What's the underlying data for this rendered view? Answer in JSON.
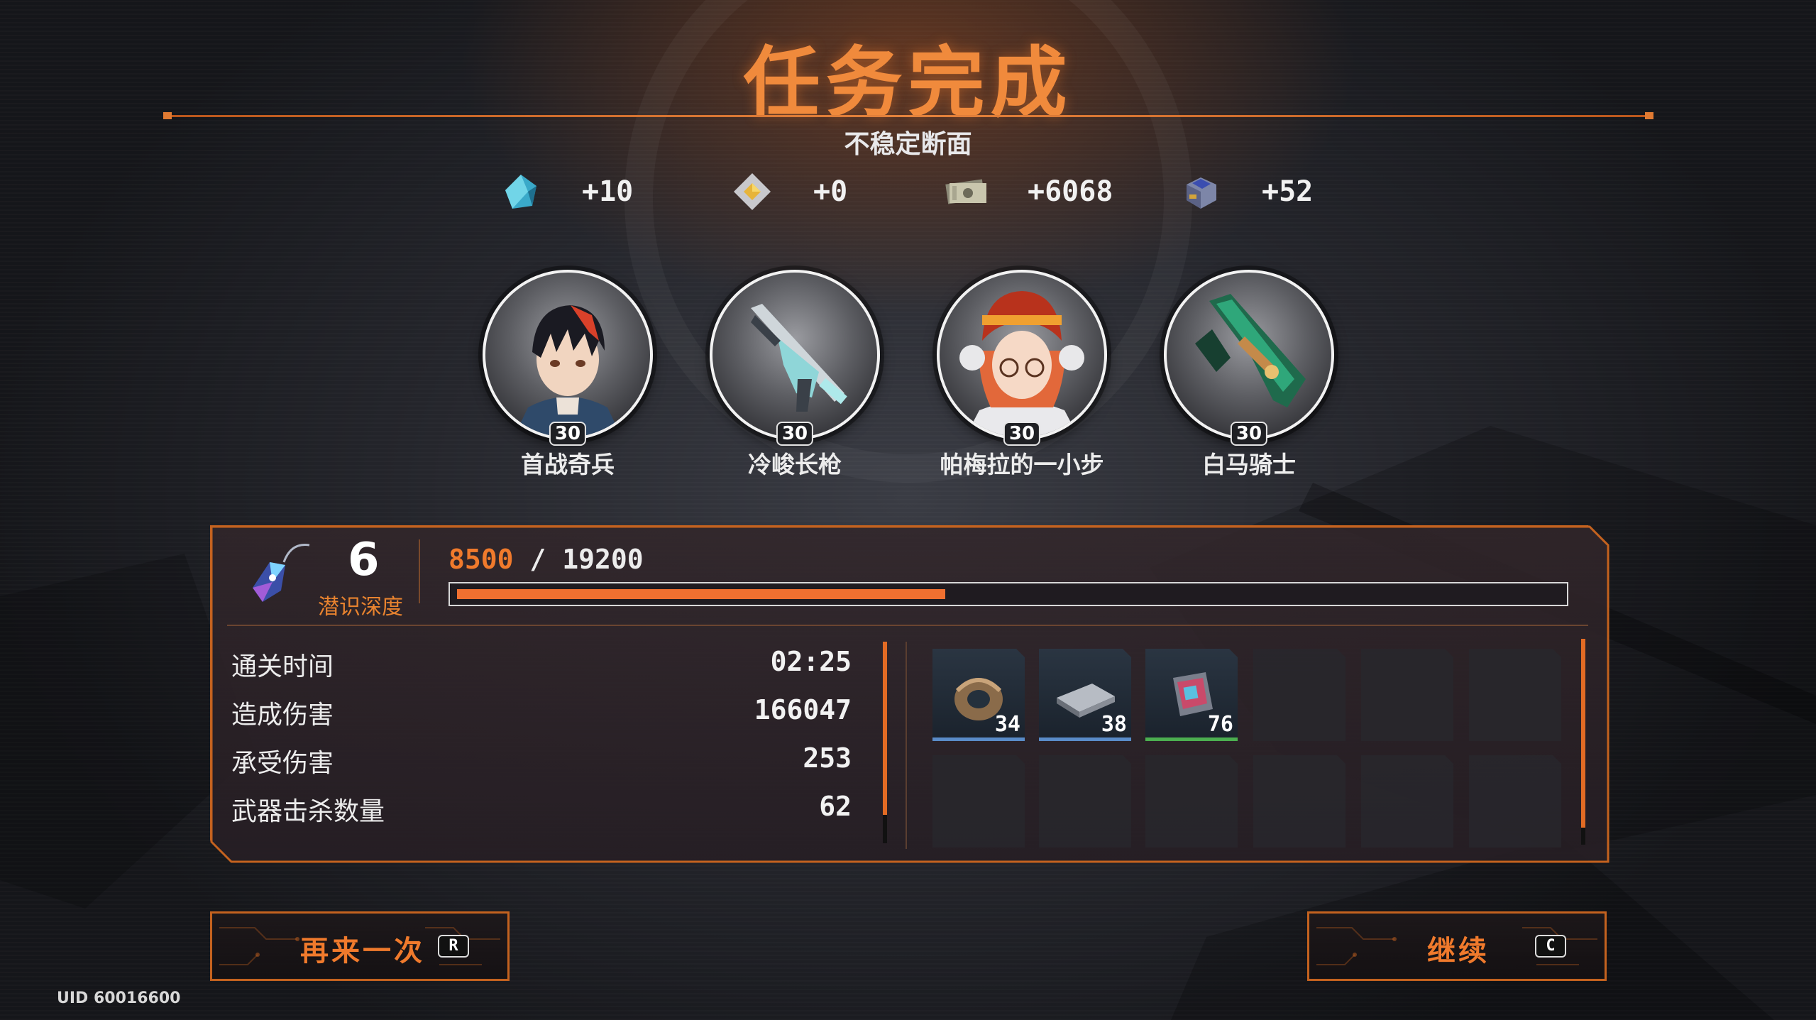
{
  "header": {
    "title": "任务完成",
    "subtitle": "不稳定断面",
    "accent_color": "#f08a3c"
  },
  "rewards": [
    {
      "icon": "crystal-icon",
      "amount": "+10"
    },
    {
      "icon": "gold-cube-icon",
      "amount": "+0"
    },
    {
      "icon": "banknotes-icon",
      "amount": "+6068"
    },
    {
      "icon": "chip-box-icon",
      "amount": "+52"
    }
  ],
  "avatars": [
    {
      "name": "首战奇兵",
      "level": "30",
      "icon": "character-portrait-icon"
    },
    {
      "name": "冷峻长枪",
      "level": "30",
      "icon": "rifle-weapon-icon"
    },
    {
      "name": "帕梅拉的一小步",
      "level": "30",
      "icon": "character-portrait-icon"
    },
    {
      "name": "白马骑士",
      "level": "30",
      "icon": "crossbow-weapon-icon"
    }
  ],
  "depth": {
    "level": "6",
    "label": "潜识深度",
    "icon": "amulet-icon",
    "current": "8500",
    "separator": "/",
    "max": "19200",
    "progress_fraction": 0.4427
  },
  "stats": [
    {
      "label": "通关时间",
      "value": "02:25"
    },
    {
      "label": "造成伤害",
      "value": "166047"
    },
    {
      "label": "承受伤害",
      "value": "253"
    },
    {
      "label": "武器击杀数量",
      "value": "62"
    }
  ],
  "loot": [
    {
      "icon": "gear-ring-icon",
      "count": "34",
      "rarity_color": "#5a8cc8"
    },
    {
      "icon": "metal-plate-icon",
      "count": "38",
      "rarity_color": "#5a8cc8"
    },
    {
      "icon": "circuit-card-icon",
      "count": "76",
      "rarity_color": "#4caf50"
    }
  ],
  "buttons": {
    "retry_label": "再来一次",
    "retry_key": "R",
    "continue_label": "继续",
    "continue_key": "C"
  },
  "uid": "UID 60016600"
}
